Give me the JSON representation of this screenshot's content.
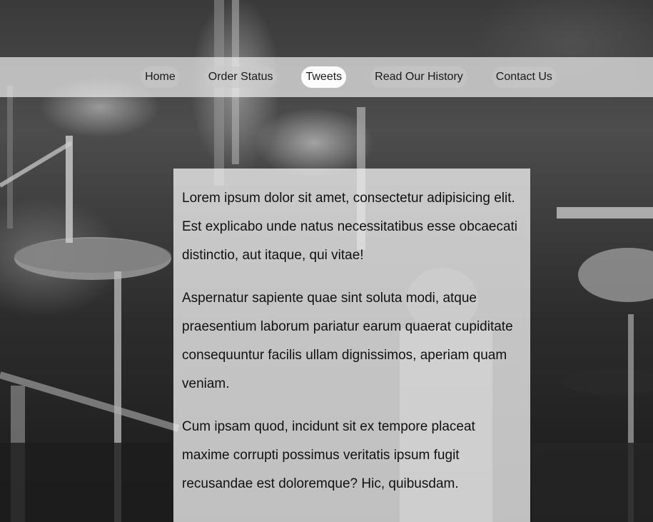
{
  "nav": {
    "items": [
      {
        "label": "Home"
      },
      {
        "label": "Order Status"
      },
      {
        "label": "Tweets"
      },
      {
        "label": "Read Our History"
      },
      {
        "label": "Contact Us"
      }
    ],
    "active_index": 2
  },
  "content": {
    "paragraphs": [
      "Lorem ipsum dolor sit amet, consectetur adipisicing elit. Est explicabo unde natus necessitatibus esse obcaecati distinctio, aut itaque, qui vitae!",
      "Aspernatur sapiente quae sint soluta modi, atque praesentium laborum pariatur earum quaerat cupiditate consequuntur facilis ullam dignissimos, aperiam quam veniam.",
      "Cum ipsam quod, incidunt sit ex tempore placeat maxime corrupti possimus veritatis ipsum fugit recusandae est doloremque? Hic, quibusdam."
    ]
  },
  "colors": {
    "nav_bar_bg": "#ebebeb",
    "nav_active_bg": "#ffffff",
    "text": "#111111",
    "panel_bg": "#f0f0f0"
  }
}
